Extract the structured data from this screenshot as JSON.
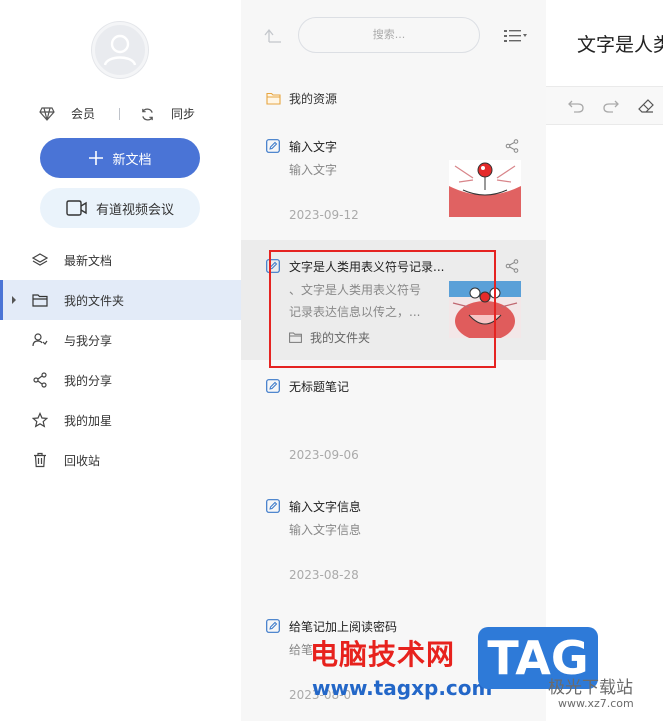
{
  "sidebar": {
    "member_label": "会员",
    "sync_label": "同步",
    "new_doc_label": "新文档",
    "meeting_label": "有道视频会议",
    "nav": [
      {
        "label": "最新文档",
        "icon": "layers-icon"
      },
      {
        "label": "我的文件夹",
        "icon": "folder-icon"
      },
      {
        "label": "与我分享",
        "icon": "shared-users-icon"
      },
      {
        "label": "我的分享",
        "icon": "share-icon"
      },
      {
        "label": "我的加星",
        "icon": "star-icon"
      },
      {
        "label": "回收站",
        "icon": "trash-icon"
      }
    ]
  },
  "list": {
    "search_placeholder": "搜索...",
    "folder_name": "我的资源",
    "notes": [
      {
        "title": "输入文字",
        "summary": "输入文字",
        "date": "2023-09-12"
      },
      {
        "title": "文字是人类用表义符号记录...",
        "summary_1": "、文字是人类用表义符号",
        "summary_2": "记录表达信息以传之，...",
        "folder": "我的文件夹"
      },
      {
        "title": "无标题笔记",
        "date": "2023-09-06"
      },
      {
        "title": "输入文字信息",
        "summary": "输入文字信息",
        "date": "2023-08-28"
      },
      {
        "title": "给笔记加上阅读密码",
        "summary": "给笔",
        "date": "2023-08-0"
      }
    ]
  },
  "editor": {
    "title": "文字是人类"
  },
  "watermark": {
    "site_cn": "电脑技术网",
    "site_url": "www.tagxp.com",
    "tag": "TAG",
    "xz_label": "极光下载站",
    "xz_url": "www.xz7.com"
  },
  "colors": {
    "accent": "#4a74d6",
    "highlight_box": "#e52321",
    "meeting_bg": "#eaf3fb",
    "active_nav_bg": "#e3ebf8"
  }
}
